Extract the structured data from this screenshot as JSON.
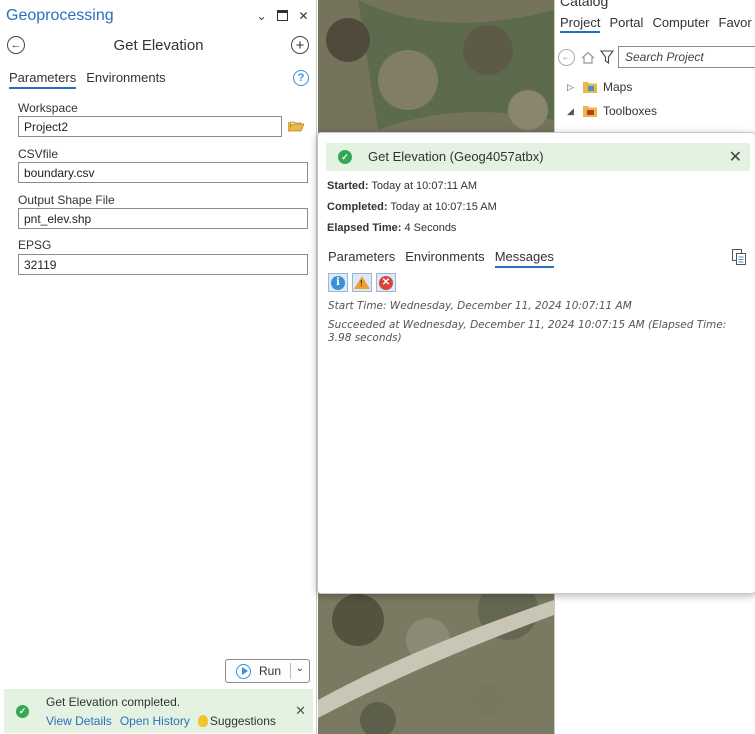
{
  "geoprocessing": {
    "title": "Geoprocessing",
    "tool_name": "Get Elevation",
    "tabs": [
      "Parameters",
      "Environments"
    ],
    "params": {
      "workspace_label": "Workspace",
      "workspace_value": "Project2",
      "csv_label": "CSVfile",
      "csv_value": "boundary.csv",
      "shape_label": "Output Shape File",
      "shape_value": "pnt_elev.shp",
      "epsg_label": "EPSG",
      "epsg_value": "32119"
    },
    "run_label": "Run",
    "status": {
      "text": "Get Elevation completed.",
      "view_details": "View Details",
      "open_history": "Open History",
      "suggestions": "Suggestions"
    }
  },
  "catalog": {
    "title": "Catalog",
    "tabs": [
      "Project",
      "Portal",
      "Computer",
      "Favor"
    ],
    "search_placeholder": "Search Project",
    "tree": [
      {
        "label": "Maps",
        "expanded": false
      },
      {
        "label": "Toolboxes",
        "expanded": true
      }
    ]
  },
  "popup": {
    "title": "Get Elevation (Geog4057atbx)",
    "started_label": "Started:",
    "started_value": "Today at 10:07:11 AM",
    "completed_label": "Completed:",
    "completed_value": "Today at 10:07:15 AM",
    "elapsed_label": "Elapsed Time:",
    "elapsed_value": "4 Seconds",
    "tabs": [
      "Parameters",
      "Environments",
      "Messages"
    ],
    "active_tab": "Messages",
    "messages": [
      "Start Time: Wednesday, December 11, 2024 10:07:11 AM",
      "Succeeded at Wednesday, December 11, 2024 10:07:15 AM (Elapsed Time: 3.98 seconds)"
    ]
  },
  "colors": {
    "accent": "#2a6fbf",
    "success_bg": "#e4f2e2",
    "success_icon": "#34a853",
    "error_icon": "#d9453a",
    "warning_icon": "#f0a030"
  }
}
